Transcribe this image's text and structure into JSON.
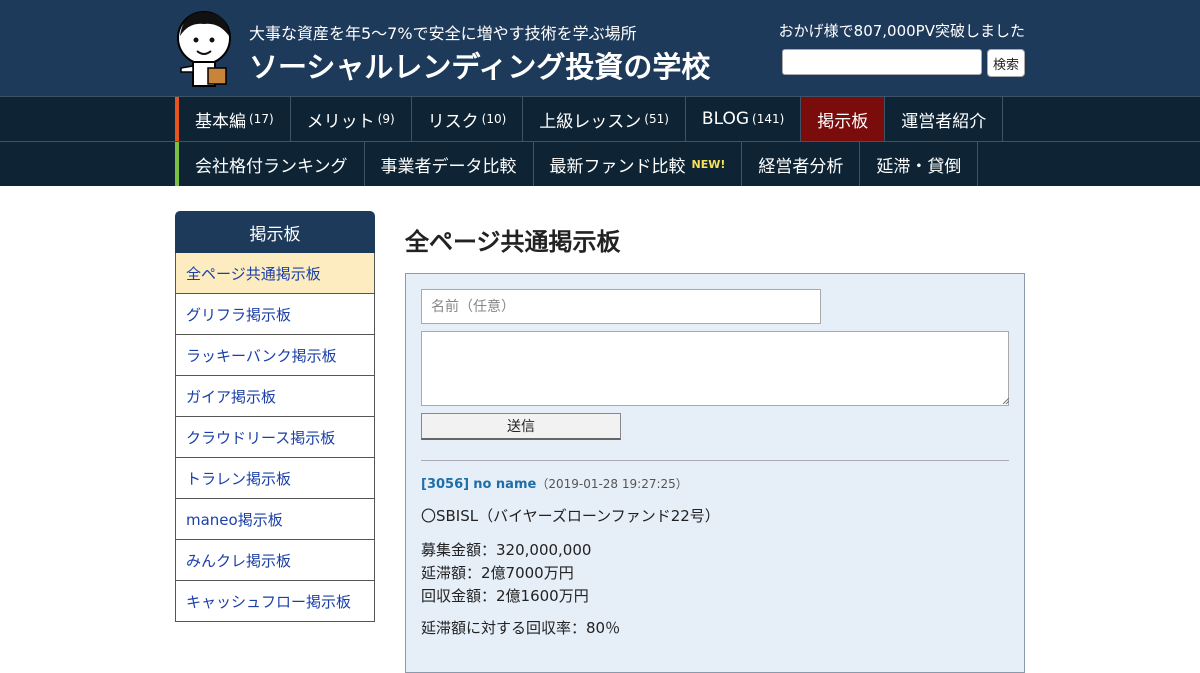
{
  "header": {
    "tagline": "大事な資産を年5～7%で安全に増やす技術を学ぶ場所",
    "title": "ソーシャルレンディング投資の学校",
    "pv_text": "おかげ様で807,000PV突破しました",
    "search_button": "検索"
  },
  "nav_primary": [
    {
      "label": "基本編",
      "count": "(17)"
    },
    {
      "label": "メリット",
      "count": "(9)"
    },
    {
      "label": "リスク",
      "count": "(10)"
    },
    {
      "label": "上級レッスン",
      "count": "(51)"
    },
    {
      "label": "BLOG",
      "count": "(141)"
    },
    {
      "label": "掲示板",
      "count": ""
    },
    {
      "label": "運営者紹介",
      "count": ""
    }
  ],
  "nav_secondary": [
    {
      "label": "会社格付ランキング"
    },
    {
      "label": "事業者データ比較"
    },
    {
      "label": "最新ファンド比較",
      "badge": "NEW!"
    },
    {
      "label": "経営者分析"
    },
    {
      "label": "延滞・貸倒"
    }
  ],
  "sidebar": {
    "title": "掲示板",
    "items": [
      "全ページ共通掲示板",
      "グリフラ掲示板",
      "ラッキーバンク掲示板",
      "ガイア掲示板",
      "クラウドリース掲示板",
      "トラレン掲示板",
      "maneo掲示板",
      "みんクレ掲示板",
      "キャッシュフロー掲示板"
    ]
  },
  "main": {
    "title": "全ページ共通掲示板",
    "form": {
      "name_placeholder": "名前（任意）",
      "submit_label": "送信"
    },
    "post": {
      "id": "[3056]",
      "author": "no name",
      "date": "（2019-01-28 19:27:25）",
      "lines": [
        "〇SBISL（バイヤーズローンファンド22号）",
        "募集金額：320,000,000",
        "延滞額：2億7000万円",
        "回収金額：2億1600万円",
        "延滞額に対する回収率：80％"
      ]
    }
  }
}
